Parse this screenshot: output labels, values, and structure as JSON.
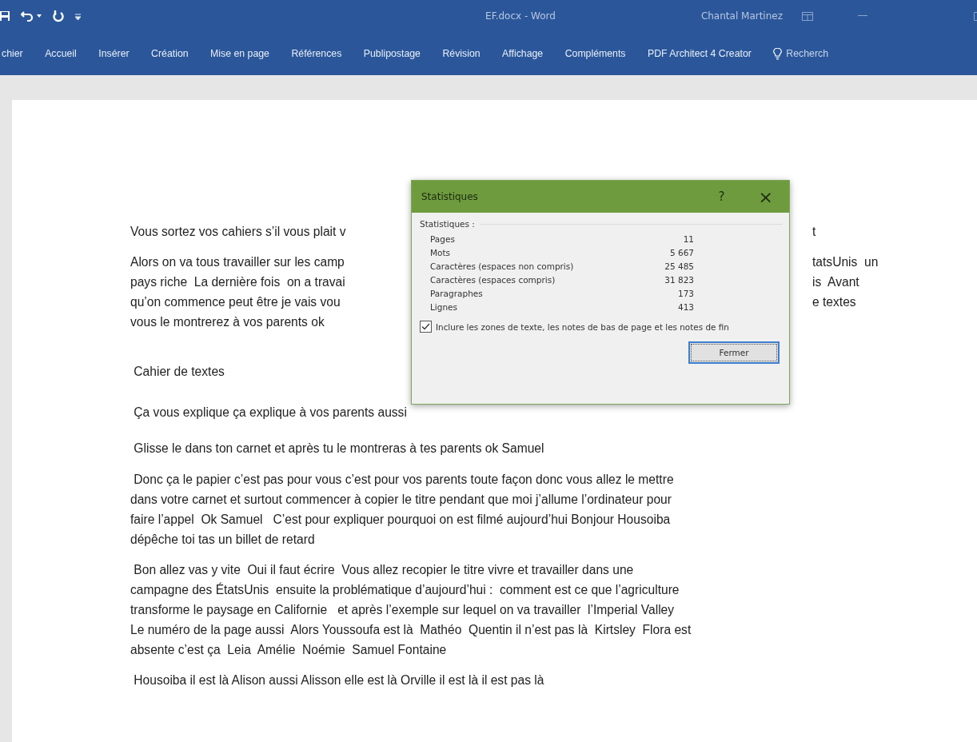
{
  "window": {
    "title": "EF.docx  -  Word",
    "user": "Chantal Martinez"
  },
  "ribbon_tabs": [
    "chier",
    "Accueil",
    "Insérer",
    "Création",
    "Mise en page",
    "Références",
    "Publipostage",
    "Révision",
    "Affichage",
    "Compléments",
    "PDF Architect 4 Creator"
  ],
  "tell_me": {
    "placeholder": "Recherch"
  },
  "document": {
    "paragraphs": [
      {
        "kind": "covered",
        "lines": [
          {
            "left": "Vous sortez vos cahiers s’il vous plait v",
            "right": "t"
          }
        ]
      },
      {
        "kind": "covered",
        "lines": [
          {
            "left": "Alors on va tous travailler sur les camp",
            "right": "tatsUnis  un"
          },
          {
            "left": "pays riche  La dernière fois  on a travai",
            "right": "is  Avant"
          },
          {
            "left": "qu’on commence peut être je vais vou",
            "right": "e textes"
          },
          {
            "left": "vous le montrerez à vos parents ok"
          }
        ]
      },
      {
        "kind": "plain",
        "lines": [
          " Cahier de textes"
        ]
      },
      {
        "kind": "plain",
        "lines": [
          " Ça vous explique ça explique à vos parents aussi"
        ]
      },
      {
        "kind": "plain",
        "lines": [
          " Glisse le dans ton carnet et après tu le montreras à tes parents ok Samuel"
        ]
      },
      {
        "kind": "plain",
        "lines": [
          " Donc ça le papier c’est pas pour vous c’est pour vos parents toute façon donc vous allez le mettre",
          "dans votre carnet et surtout commencer à copier le titre pendant que moi j’allume l’ordinateur pour",
          "faire l’appel  Ok Samuel   C’est pour expliquer pourquoi on est filmé aujourd’hui Bonjour Housoiba",
          "dépêche toi tas un billet de retard"
        ]
      },
      {
        "kind": "plain",
        "lines": [
          " Bon allez vas y vite  Oui il faut écrire  Vous allez recopier le titre vivre et travailler dans une",
          "campagne des ÉtatsUnis  ensuite la problématique d’aujourd’hui :  comment est ce que l’agriculture",
          "transforme le paysage en Californie   et après l’exemple sur lequel on va travailler  l’Imperial Valley",
          "Le numéro de la page aussi  Alors Youssoufa est là  Mathéo  Quentin il n’est pas là  Kirtsley  Flora est",
          "absente c’est ça  Leia  Amélie  Noémie  Samuel Fontaine"
        ]
      },
      {
        "kind": "plain",
        "lines": [
          " Housoiba il est là Alison aussi Alisson elle est là Orville il est là il est pas là"
        ]
      }
    ]
  },
  "dialog": {
    "title": "Statistiques",
    "help": "?",
    "close": "×",
    "group_label": "Statistiques :",
    "rows": [
      {
        "label": "Pages",
        "value": "11"
      },
      {
        "label": "Mots",
        "value": "5 667"
      },
      {
        "label": "Caractères (espaces non compris)",
        "value": "25 485"
      },
      {
        "label": "Caractères (espaces compris)",
        "value": "31 823"
      },
      {
        "label": "Paragraphes",
        "value": "173"
      },
      {
        "label": "Lignes",
        "value": "413"
      }
    ],
    "include_checkbox": {
      "label": "Inclure les zones de texte, les notes de bas de page et les notes de fin",
      "checked": true
    },
    "close_button": "Fermer"
  }
}
